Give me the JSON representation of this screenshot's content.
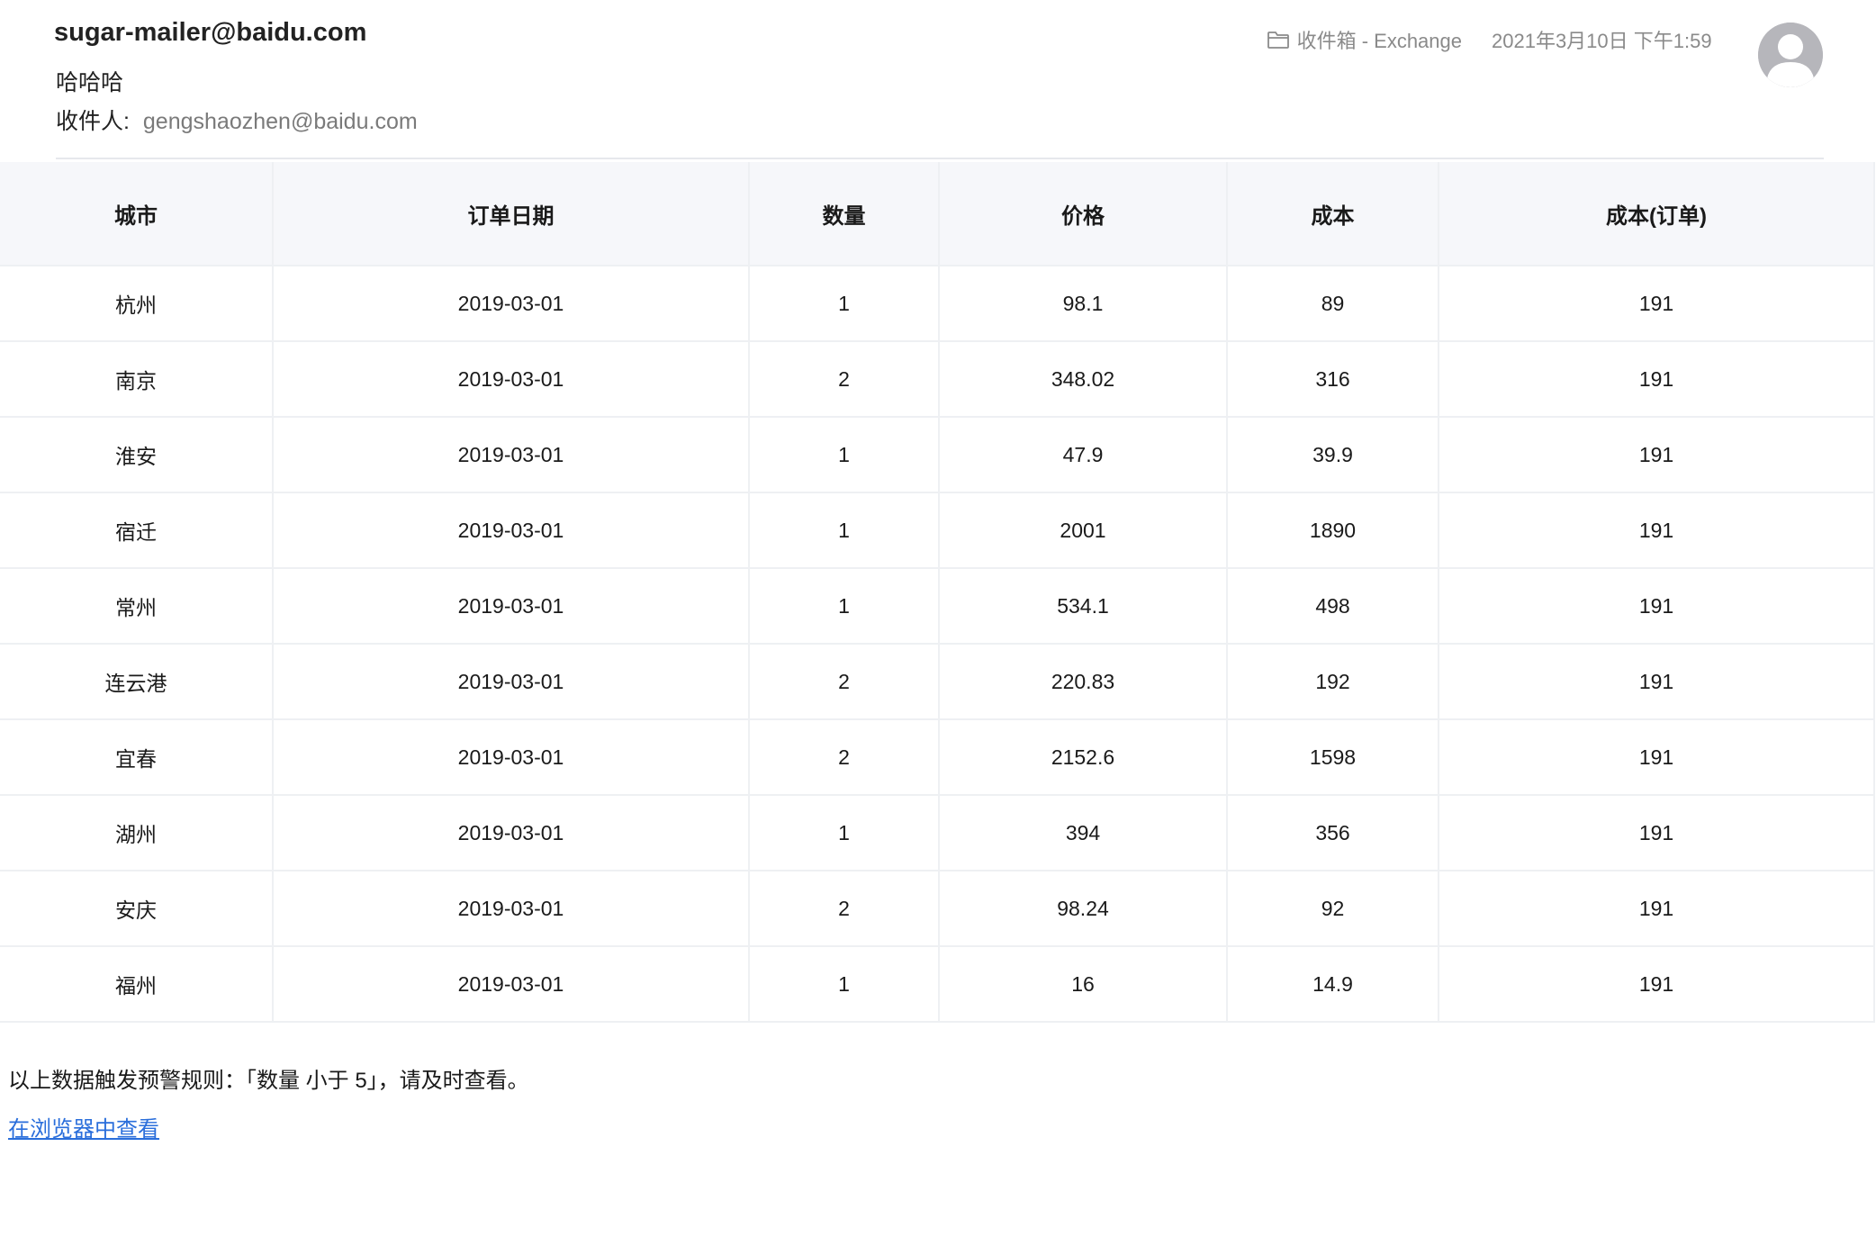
{
  "header": {
    "sender": "sugar-mailer@baidu.com",
    "subject": "哈哈哈",
    "recipient_label": "收件人:",
    "recipient": "gengshaozhen@baidu.com",
    "folder": "收件箱 - Exchange",
    "datetime": "2021年3月10日 下午1:59"
  },
  "table": {
    "columns": [
      "城市",
      "订单日期",
      "数量",
      "价格",
      "成本",
      "成本(订单)"
    ],
    "rows": [
      [
        "杭州",
        "2019-03-01",
        "1",
        "98.1",
        "89",
        "191"
      ],
      [
        "南京",
        "2019-03-01",
        "2",
        "348.02",
        "316",
        "191"
      ],
      [
        "淮安",
        "2019-03-01",
        "1",
        "47.9",
        "39.9",
        "191"
      ],
      [
        "宿迁",
        "2019-03-01",
        "1",
        "2001",
        "1890",
        "191"
      ],
      [
        "常州",
        "2019-03-01",
        "1",
        "534.1",
        "498",
        "191"
      ],
      [
        "连云港",
        "2019-03-01",
        "2",
        "220.83",
        "192",
        "191"
      ],
      [
        "宜春",
        "2019-03-01",
        "2",
        "2152.6",
        "1598",
        "191"
      ],
      [
        "湖州",
        "2019-03-01",
        "1",
        "394",
        "356",
        "191"
      ],
      [
        "安庆",
        "2019-03-01",
        "2",
        "98.24",
        "92",
        "191"
      ],
      [
        "福州",
        "2019-03-01",
        "1",
        "16",
        "14.9",
        "191"
      ]
    ]
  },
  "footer": {
    "alert_text": "以上数据触发预警规则：「数量 小于 5」，请及时查看。",
    "link_text": "在浏览器中查看"
  },
  "icons": {
    "folder": "folder-icon",
    "avatar": "user-avatar-icon"
  },
  "colors": {
    "link": "#2a6edb",
    "header_bg": "#f6f7fa",
    "muted_text": "#8a8a8a"
  }
}
